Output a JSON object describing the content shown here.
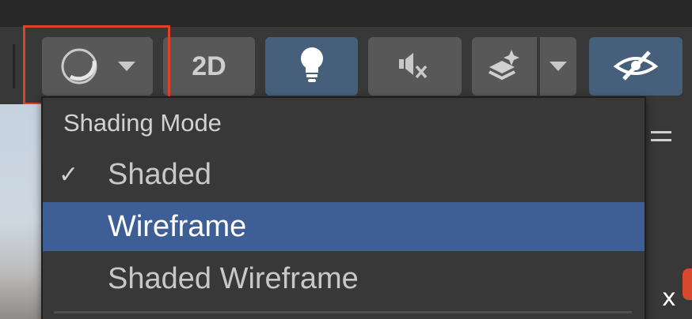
{
  "toolbar": {
    "shading_button_icon": "sphere-shaded-icon",
    "two_d_label": "2D",
    "lighting_icon": "lightbulb-icon",
    "audio_icon": "audio-mute-icon",
    "effects_icon": "effects-layers-icon",
    "visibility_icon": "eye-hidden-icon"
  },
  "menu": {
    "header": "Shading Mode",
    "items": [
      {
        "label": "Shaded",
        "checked": true,
        "selected": false
      },
      {
        "label": "Wireframe",
        "checked": false,
        "selected": true
      },
      {
        "label": "Shaded Wireframe",
        "checked": false,
        "selected": false
      }
    ],
    "check_glyph": "✓"
  },
  "viewport": {
    "axis_label": "x"
  },
  "colors": {
    "highlight": "#e2402b",
    "selection": "#3e5f96",
    "active_button": "#46607c"
  }
}
